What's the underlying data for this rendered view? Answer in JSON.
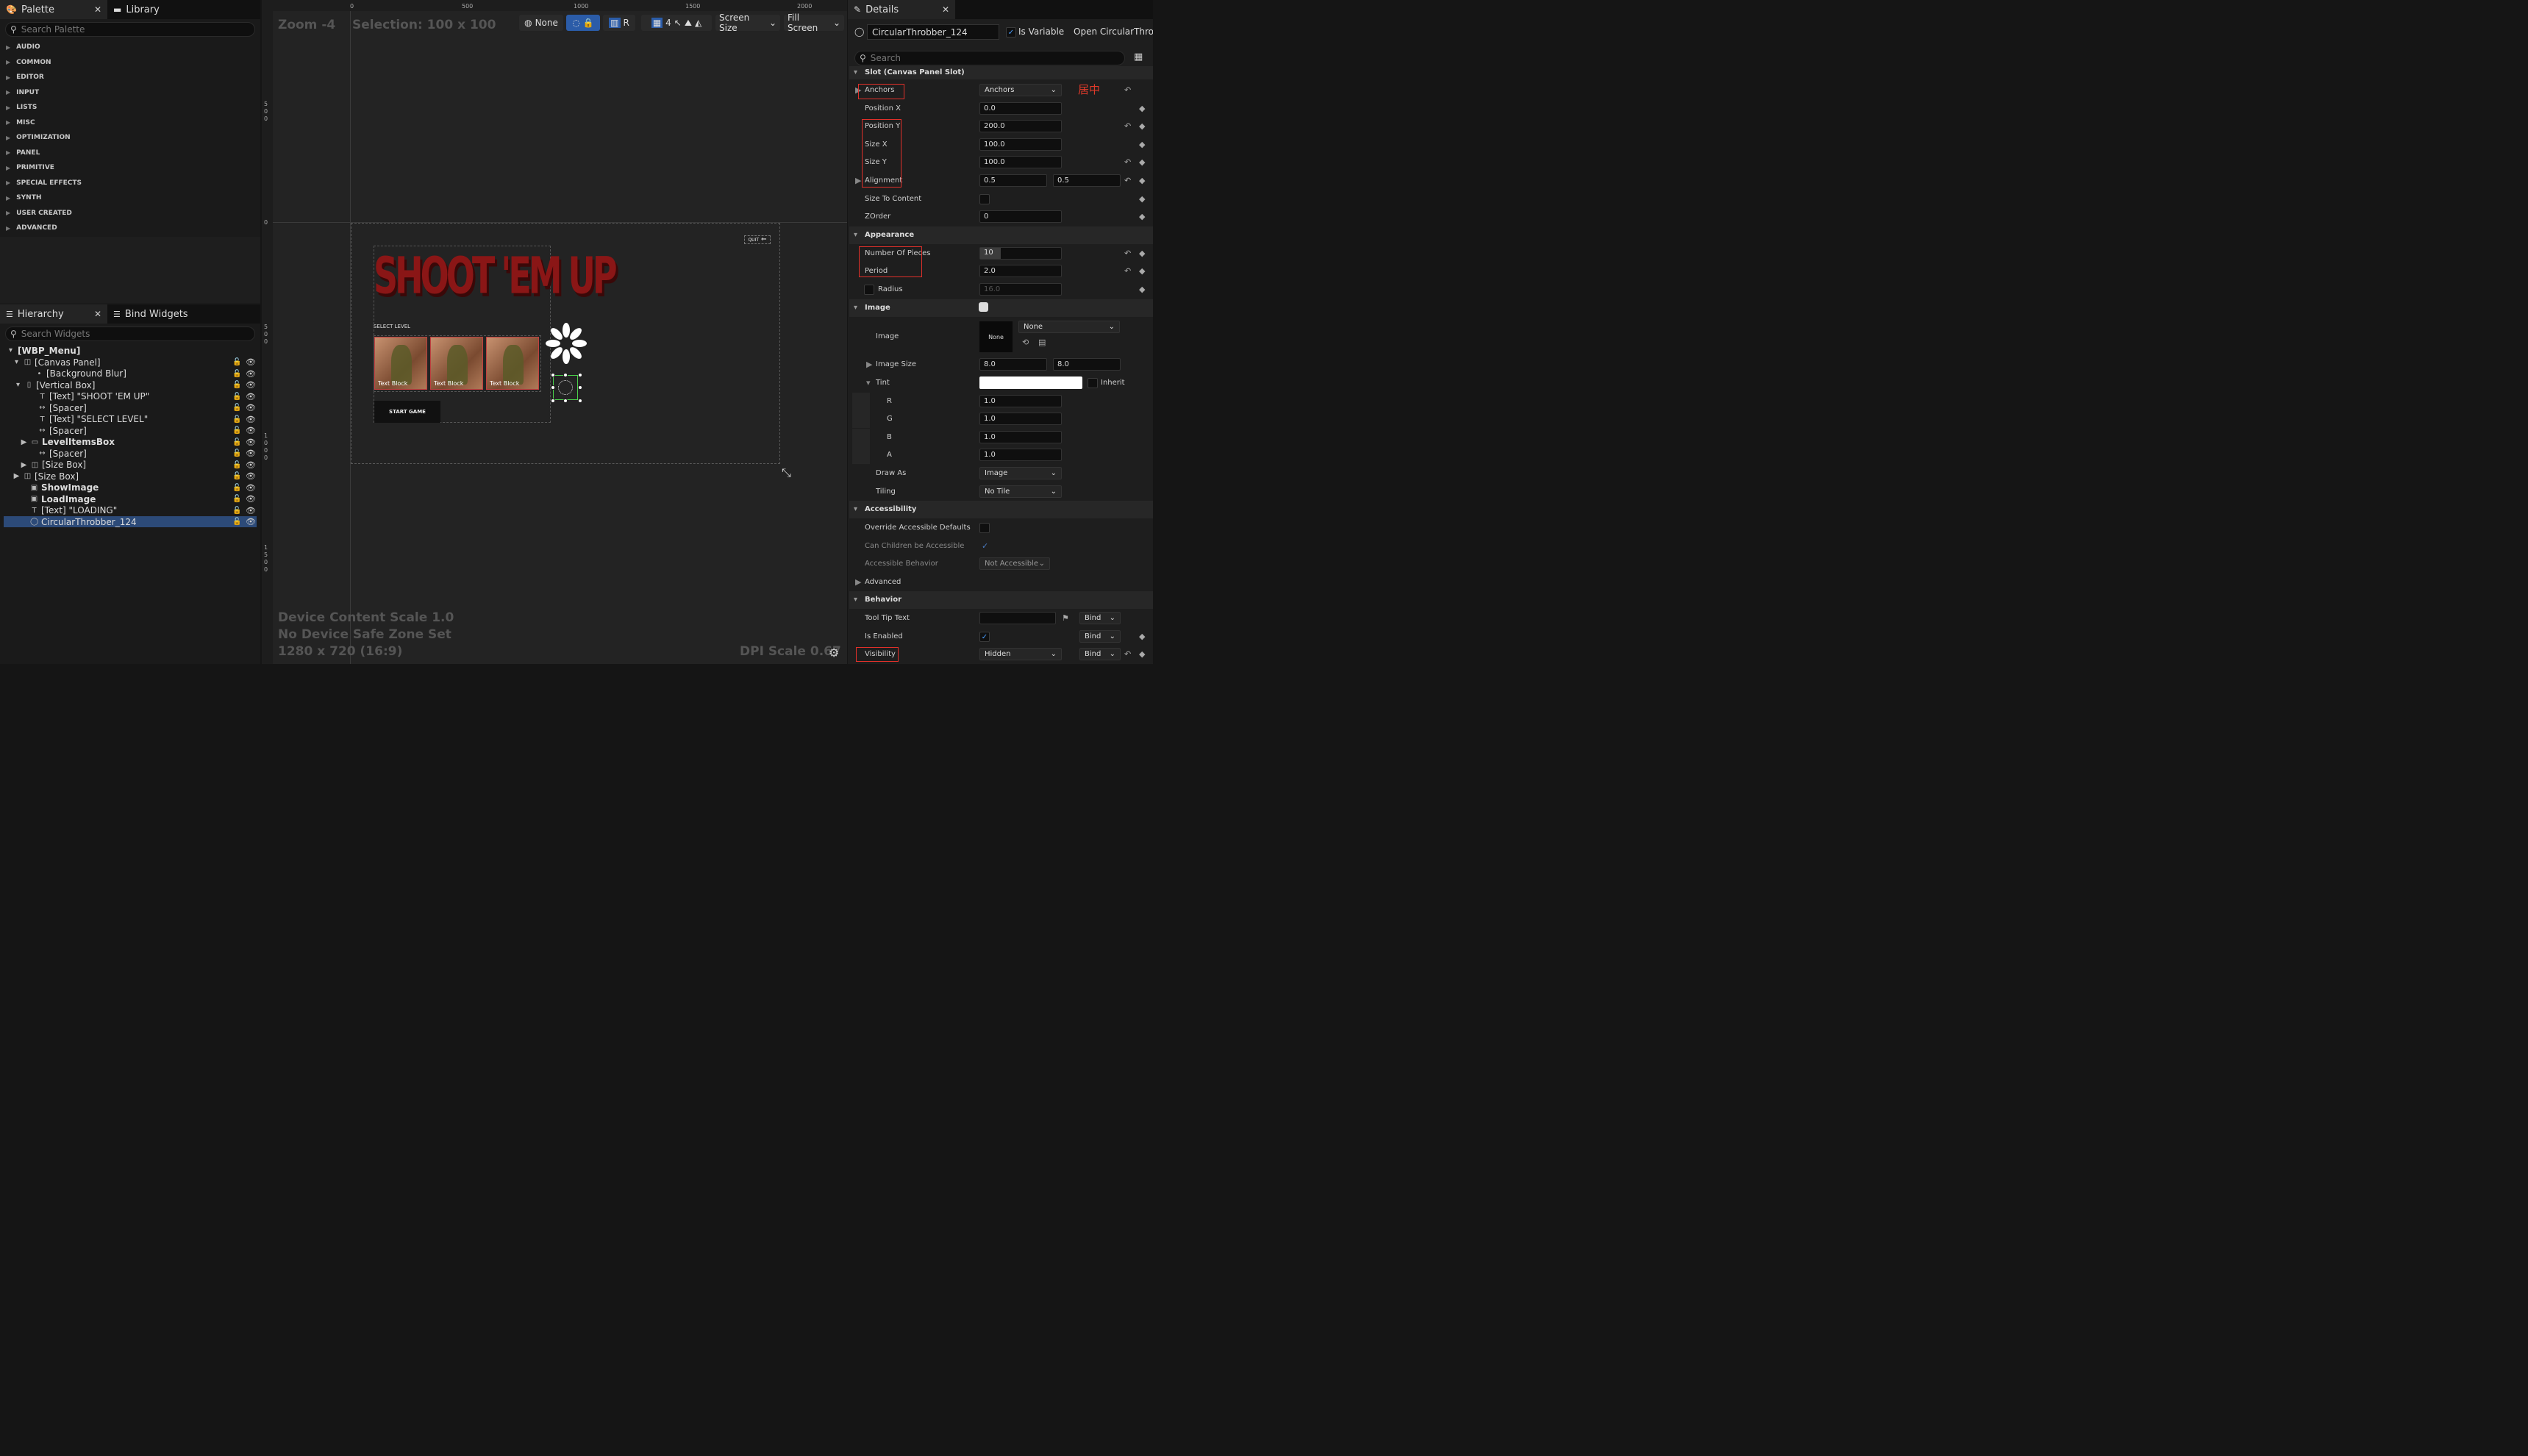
{
  "palette": {
    "tab_label": "Palette",
    "library_label": "Library",
    "search_placeholder": "Search Palette",
    "categories": [
      "AUDIO",
      "COMMON",
      "EDITOR",
      "INPUT",
      "LISTS",
      "MISC",
      "OPTIMIZATION",
      "PANEL",
      "PRIMITIVE",
      "SPECIAL EFFECTS",
      "SYNTH",
      "USER CREATED",
      "ADVANCED"
    ]
  },
  "hierarchy": {
    "tab_label": "Hierarchy",
    "bind_label": "Bind Widgets",
    "search_placeholder": "Search Widgets",
    "root": "[WBP_Menu]",
    "items": [
      "[Canvas Panel]",
      "[Background Blur]",
      "[Vertical Box]",
      "[Text] \"SHOOT 'EM UP\"",
      "[Spacer]",
      "[Text] \"SELECT LEVEL\"",
      "[Spacer]",
      "LevelItemsBox",
      "[Spacer]",
      "[Size Box]",
      "[Size Box]",
      "ShowImage",
      "LoadImage",
      "[Text] \"LOADING\"",
      "CircularThrobber_124"
    ]
  },
  "viewport": {
    "zoom": "Zoom -4",
    "selection": "Selection: 100 x 100",
    "none_label": "None",
    "r_label": "R",
    "grid_num": "4",
    "screen_size": "Screen Size",
    "fill_screen": "Fill Screen",
    "ruler_ticks": [
      "0",
      "500",
      "1000",
      "1500",
      "2000"
    ],
    "vruler": [
      "500",
      "0",
      "500",
      "1000",
      "1500"
    ],
    "title_text": "SHOOT 'EM UP",
    "select_level": "SELECT LEVEL",
    "text_block": "Text Block",
    "start_game": "START GAME",
    "quit": "QUIT",
    "device_scale": "Device Content Scale 1.0",
    "safe_zone": "No Device Safe Zone Set",
    "resolution": "1280 x 720 (16:9)",
    "dpi": "DPI Scale 0.67"
  },
  "details": {
    "tab_label": "Details",
    "object_name": "CircularThrobber_124",
    "is_variable": "Is Variable",
    "open_link": "Open CircularThrobb",
    "search_placeholder": "Search",
    "slot_header": "Slot (Canvas Panel Slot)",
    "anchors_label": "Anchors",
    "anchors_value": "Anchors",
    "annotation": "居中",
    "position_x_label": "Position X",
    "position_x": "0.0",
    "position_y_label": "Position Y",
    "position_y": "200.0",
    "size_x_label": "Size X",
    "size_x": "100.0",
    "size_y_label": "Size Y",
    "size_y": "100.0",
    "alignment_label": "Alignment",
    "alignment_x": "0.5",
    "alignment_y": "0.5",
    "size_to_content": "Size To Content",
    "zorder_label": "ZOrder",
    "zorder": "0",
    "appearance": "Appearance",
    "pieces_label": "Number Of Pieces",
    "pieces": "10",
    "pieces_fraction": 0.25,
    "period_label": "Period",
    "period": "2.0",
    "radius_label": "Radius",
    "radius": "16.0",
    "image_section": "Image",
    "image_label": "Image",
    "image_thumb": "None",
    "image_dropdown": "None",
    "image_size_label": "Image Size",
    "image_size_x": "8.0",
    "image_size_y": "8.0",
    "tint_label": "Tint",
    "inherit": "Inherit",
    "r_label": "R",
    "r": "1.0",
    "g_label": "G",
    "g": "1.0",
    "b_label": "B",
    "b": "1.0",
    "a_label": "A",
    "a": "1.0",
    "draw_as_label": "Draw As",
    "draw_as": "Image",
    "tiling_label": "Tiling",
    "tiling": "No Tile",
    "accessibility": "Accessibility",
    "override_label": "Override Accessible Defaults",
    "can_children_label": "Can Children be Accessible",
    "behavior_acc_label": "Accessible Behavior",
    "behavior_acc": "Not Accessible",
    "advanced": "Advanced",
    "behavior": "Behavior",
    "tooltip_label": "Tool Tip Text",
    "bind": "Bind",
    "is_enabled_label": "Is Enabled",
    "visibility_label": "Visibility",
    "visibility": "Hidden"
  }
}
